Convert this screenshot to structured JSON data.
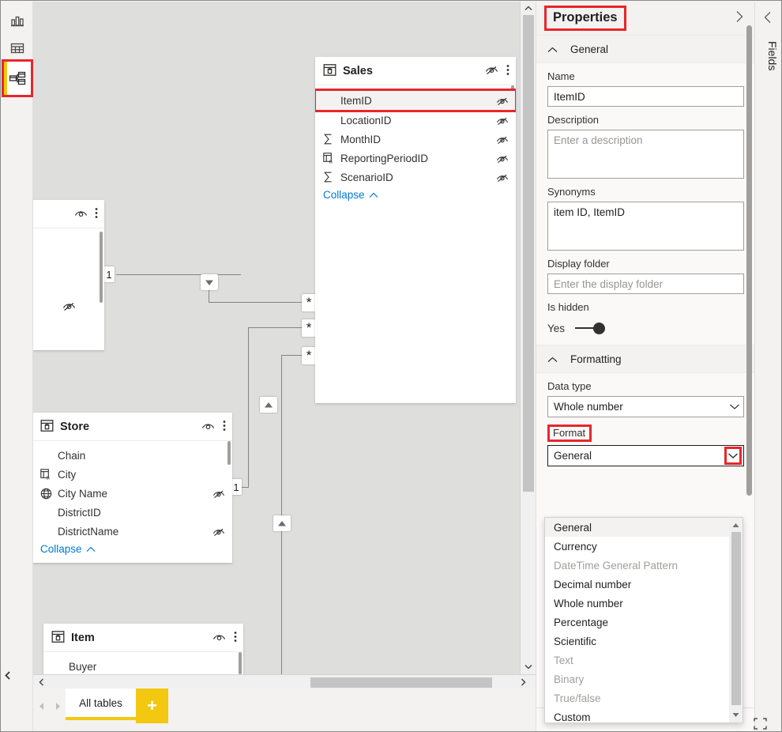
{
  "rail": {
    "items": [
      {
        "name": "report-view",
        "icon": "bar-chart-icon",
        "selected": false
      },
      {
        "name": "data-view",
        "icon": "table-icon",
        "selected": false
      },
      {
        "name": "model-view",
        "icon": "model-relationships-icon",
        "selected": true
      }
    ]
  },
  "canvas": {
    "tables": [
      {
        "id": "partial-top-left",
        "title": "",
        "fields": [],
        "collapse_label": "",
        "header_eye": "eye-visible-icon",
        "menu": "more-options-icon"
      },
      {
        "id": "sales",
        "title": "Sales",
        "header_eye": "eye-hidden-icon",
        "menu": "more-options-icon",
        "collapse_label": "Collapse",
        "fields": [
          {
            "label": "ItemID",
            "icon": "none",
            "hidden_icon": "eye-hidden-icon",
            "selected": true
          },
          {
            "label": "LocationID",
            "icon": "none",
            "hidden_icon": "eye-hidden-icon",
            "selected": false
          },
          {
            "label": "MonthID",
            "icon": "sigma-icon",
            "hidden_icon": "eye-hidden-icon",
            "selected": false
          },
          {
            "label": "ReportingPeriodID",
            "icon": "calculated-column-icon",
            "hidden_icon": "eye-hidden-icon",
            "selected": false
          },
          {
            "label": "ScenarioID",
            "icon": "sigma-icon",
            "hidden_icon": "eye-hidden-icon",
            "selected": false
          }
        ]
      },
      {
        "id": "store",
        "title": "Store",
        "header_eye": "eye-visible-icon",
        "menu": "more-options-icon",
        "collapse_label": "Collapse",
        "fields": [
          {
            "label": "Chain",
            "icon": "none",
            "hidden_icon": "none",
            "selected": false
          },
          {
            "label": "City",
            "icon": "calculated-column-icon",
            "hidden_icon": "none",
            "selected": false
          },
          {
            "label": "City Name",
            "icon": "globe-icon",
            "hidden_icon": "eye-hidden-icon",
            "selected": false
          },
          {
            "label": "DistrictID",
            "icon": "none",
            "hidden_icon": "none",
            "selected": false
          },
          {
            "label": "DistrictName",
            "icon": "none",
            "hidden_icon": "eye-hidden-icon",
            "selected": false
          }
        ]
      },
      {
        "id": "item",
        "title": "Item",
        "header_eye": "eye-visible-icon",
        "menu": "more-options-icon",
        "collapse_label": "",
        "fields": [
          {
            "label": "Buyer",
            "icon": "none",
            "hidden_icon": "none",
            "selected": false
          }
        ]
      }
    ],
    "cardinality": {
      "one": "1",
      "many": "*"
    }
  },
  "tabbar": {
    "all_tables_label": "All tables",
    "add_label": "+",
    "prev_icon": "prev-arrow-icon",
    "next_icon": "next-arrow-icon"
  },
  "properties": {
    "title": "Properties",
    "expand_icon": "chevron-right-icon",
    "sections": {
      "general": {
        "label": "General",
        "collapse_icon": "chevron-up-icon",
        "name": {
          "label": "Name",
          "value": "ItemID"
        },
        "description": {
          "label": "Description",
          "placeholder": "Enter a description",
          "value": ""
        },
        "synonyms": {
          "label": "Synonyms",
          "value": "item ID, ItemID"
        },
        "display_folder": {
          "label": "Display folder",
          "placeholder": "Enter the display folder",
          "value": ""
        },
        "is_hidden": {
          "label": "Is hidden",
          "state_label": "Yes",
          "on": true
        }
      },
      "formatting": {
        "label": "Formatting",
        "collapse_icon": "chevron-up-icon",
        "data_type": {
          "label": "Data type",
          "value": "Whole number"
        },
        "format": {
          "label": "Format",
          "value": "General"
        }
      }
    },
    "format_dropdown_options": [
      {
        "label": "General",
        "selected": true,
        "disabled": false
      },
      {
        "label": "Currency",
        "selected": false,
        "disabled": false
      },
      {
        "label": "DateTime General Pattern",
        "selected": false,
        "disabled": true
      },
      {
        "label": "Decimal number",
        "selected": false,
        "disabled": false
      },
      {
        "label": "Whole number",
        "selected": false,
        "disabled": false
      },
      {
        "label": "Percentage",
        "selected": false,
        "disabled": false
      },
      {
        "label": "Scientific",
        "selected": false,
        "disabled": false
      },
      {
        "label": "Text",
        "selected": false,
        "disabled": true
      },
      {
        "label": "Binary",
        "selected": false,
        "disabled": true
      },
      {
        "label": "True/false",
        "selected": false,
        "disabled": true
      },
      {
        "label": "Custom",
        "selected": false,
        "disabled": false
      }
    ]
  },
  "fields_pane": {
    "label": "Fields",
    "collapse_icon": "chevron-left-icon"
  },
  "footer": {
    "fit_icon": "fit-to-screen-icon"
  },
  "colors": {
    "accent_yellow": "#f2c811",
    "highlight_red": "#e8262b",
    "link_blue": "#0078d4",
    "canvas_bg": "#dededd",
    "panel_bg": "#f3f2f1"
  }
}
